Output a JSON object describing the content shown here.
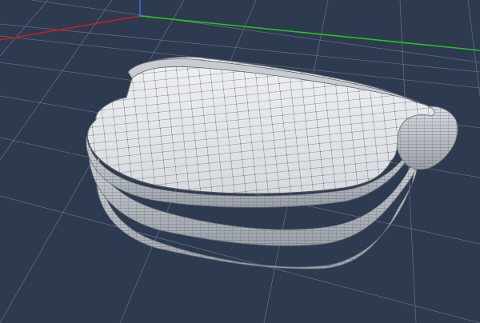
{
  "viewport": {
    "view": "perspective",
    "background": "#2e3a50",
    "grid_color": "#6e7a8c",
    "axis_colors": {
      "x": "#c81e1e",
      "y": "#1ec81e",
      "z": "#4a66d6"
    }
  },
  "model": {
    "name": "",
    "shading": "smooth-shaded-with-wireframe",
    "surface_color": "#e3e6ea",
    "wire_color": "#5a5f66"
  }
}
